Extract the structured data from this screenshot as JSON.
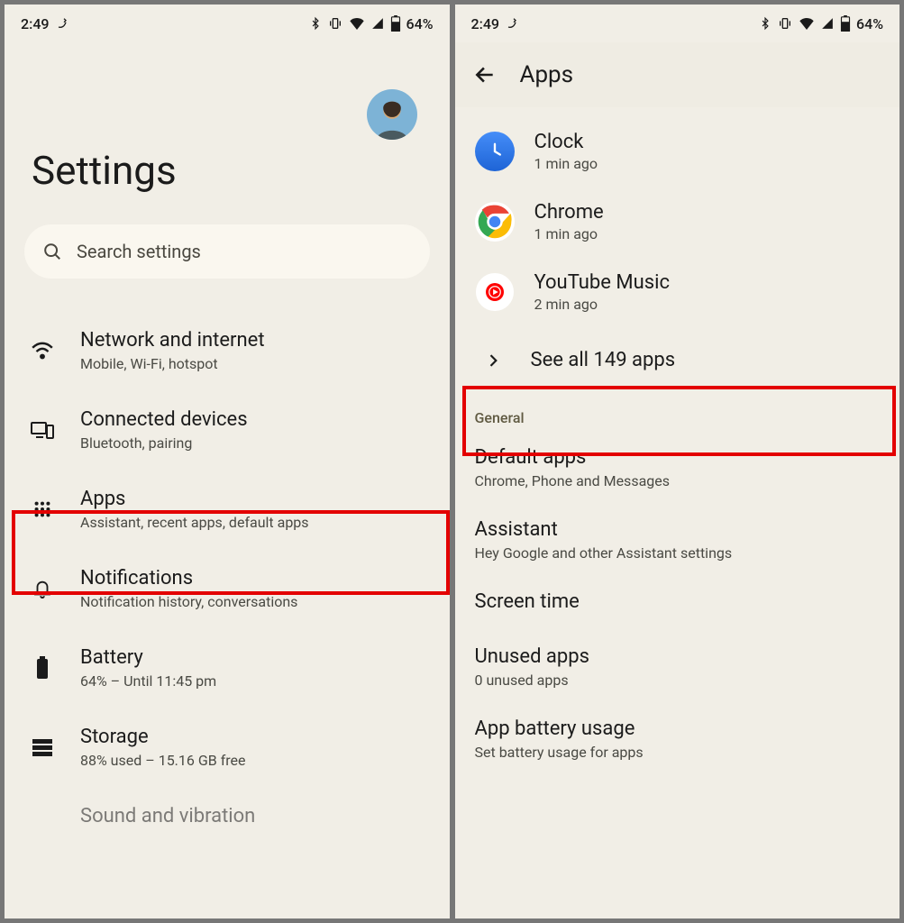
{
  "status": {
    "time": "2:49",
    "battery": "64%"
  },
  "screen1": {
    "title": "Settings",
    "search_placeholder": "Search settings",
    "items": [
      {
        "title": "Network and internet",
        "sub": "Mobile, Wi-Fi, hotspot"
      },
      {
        "title": "Connected devices",
        "sub": "Bluetooth, pairing"
      },
      {
        "title": "Apps",
        "sub": "Assistant, recent apps, default apps"
      },
      {
        "title": "Notifications",
        "sub": "Notification history, conversations"
      },
      {
        "title": "Battery",
        "sub": "64% – Until 11:45 pm"
      },
      {
        "title": "Storage",
        "sub": "88% used – 15.16 GB free"
      },
      {
        "title": "Sound and vibration",
        "sub": ""
      }
    ]
  },
  "screen2": {
    "title": "Apps",
    "recent": [
      {
        "name": "Clock",
        "time": "1 min ago"
      },
      {
        "name": "Chrome",
        "time": "1 min ago"
      },
      {
        "name": "YouTube Music",
        "time": "2 min ago"
      }
    ],
    "see_all": "See all 149 apps",
    "general_header": "General",
    "general": [
      {
        "title": "Default apps",
        "sub": "Chrome, Phone and Messages"
      },
      {
        "title": "Assistant",
        "sub": "Hey Google and other Assistant settings"
      },
      {
        "title": "Screen time",
        "sub": ""
      },
      {
        "title": "Unused apps",
        "sub": "0 unused apps"
      },
      {
        "title": "App battery usage",
        "sub": "Set battery usage for apps"
      }
    ]
  }
}
